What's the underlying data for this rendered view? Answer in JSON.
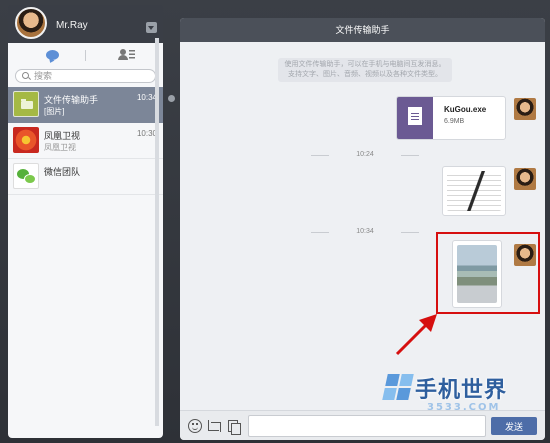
{
  "profile": {
    "name": "Mr.Ray"
  },
  "search": {
    "placeholder": "搜索"
  },
  "contacts": [
    {
      "name": "文件传输助手",
      "preview": "[图片]",
      "time": "10:34"
    },
    {
      "name": "凤凰卫视",
      "preview": "凤凰卫视",
      "time": "10:30"
    },
    {
      "name": "微信团队",
      "preview": "",
      "time": ""
    }
  ],
  "chat": {
    "title": "文件传输助手",
    "notice_line1": "使用文件传输助手，可以在手机与电脑间互发消息。",
    "notice_line2": "支持文字、图片、音频、视频以及各种文件类型。",
    "file_message": {
      "name": "KuGou.exe",
      "size": "6.9MB"
    },
    "time_separators": [
      "10:24",
      "10:34"
    ],
    "send_label": "发送"
  },
  "watermark": {
    "text": "手机世界",
    "sub": "3533.COM"
  },
  "colors": {
    "header": "#4b5059",
    "active_contact": "#7c8698",
    "send_button": "#4d6da8",
    "highlight": "#d60f0f"
  },
  "icons": [
    "avatar",
    "chevron-down-icon",
    "chat-bubble-icon",
    "contacts-icon",
    "search-icon",
    "folder-icon",
    "file-icon",
    "emoji-icon",
    "screenshot-icon",
    "file-send-icon",
    "arrow-icon"
  ]
}
